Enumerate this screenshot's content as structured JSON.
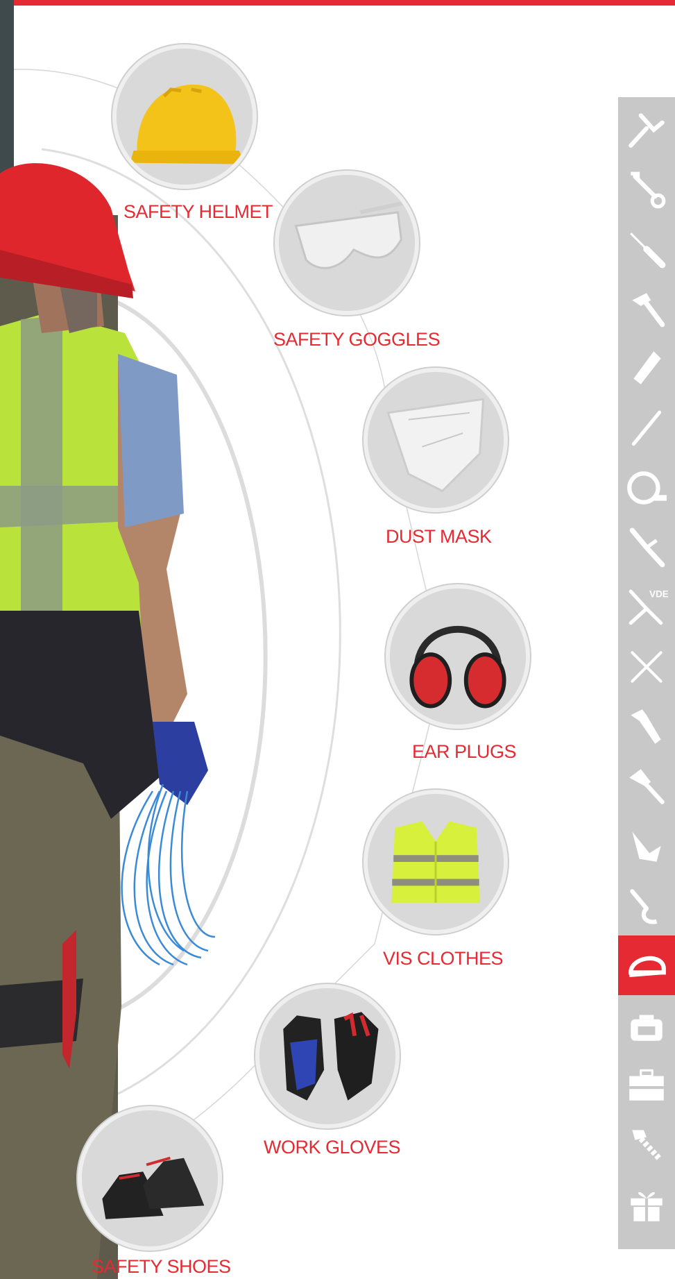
{
  "products": [
    {
      "id": "helmet",
      "label": "SAFETY HELMET",
      "icon": "safety-helmet-image"
    },
    {
      "id": "goggles",
      "label": "SAFETY GOGGLES",
      "icon": "safety-goggles-image"
    },
    {
      "id": "mask",
      "label": "DUST MASK",
      "icon": "dust-mask-image"
    },
    {
      "id": "earplugs",
      "label": "EAR PLUGS",
      "icon": "ear-muffs-image"
    },
    {
      "id": "vis",
      "label": "VIS CLOTHES",
      "icon": "hi-vis-vest-image"
    },
    {
      "id": "gloves",
      "label": "WORK GLOVES",
      "icon": "work-gloves-image"
    },
    {
      "id": "shoes",
      "label": "SAFETY SHOES",
      "icon": "safety-shoes-image"
    }
  ],
  "sidebar": {
    "items": [
      {
        "icon": "pliers-icon",
        "active": false
      },
      {
        "icon": "wrench-icon",
        "active": false
      },
      {
        "icon": "screwdriver-icon",
        "active": false
      },
      {
        "icon": "hammer-icon",
        "active": false
      },
      {
        "icon": "utility-knife-icon",
        "active": false
      },
      {
        "icon": "chisel-icon",
        "active": false
      },
      {
        "icon": "tape-measure-icon",
        "active": false
      },
      {
        "icon": "crimping-pliers-icon",
        "active": false
      },
      {
        "icon": "vde-pliers-icon",
        "active": false,
        "badge": "VDE"
      },
      {
        "icon": "crossed-tools-icon",
        "active": false
      },
      {
        "icon": "pipe-wrench-icon",
        "active": false
      },
      {
        "icon": "scraper-icon",
        "active": false
      },
      {
        "icon": "multitool-icon",
        "active": false
      },
      {
        "icon": "pruning-shears-icon",
        "active": false
      },
      {
        "icon": "safety-helmet-icon",
        "active": true
      },
      {
        "icon": "tool-bag-icon",
        "active": false
      },
      {
        "icon": "toolbox-icon",
        "active": false
      },
      {
        "icon": "fasteners-icon",
        "active": false
      },
      {
        "icon": "gift-set-icon",
        "active": false
      }
    ]
  },
  "colors": {
    "accent": "#e52a33",
    "sidebar": "#c8c8c8",
    "circle": "#dadada"
  }
}
